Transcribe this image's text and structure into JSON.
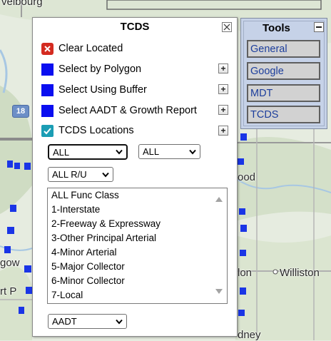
{
  "map": {
    "labels": {
      "top_left": "velbourg",
      "wood": "ood",
      "ton": "lon",
      "williston": "Williston",
      "gow": "gow",
      "rtp": "rt P",
      "dney": "dney"
    },
    "route_shield": "18",
    "colors": {
      "dots": "#1a35e6",
      "base": "#e6ece0"
    }
  },
  "tcds_panel": {
    "title": "TCDS",
    "close_icon": "close-icon",
    "clear_located": "Clear Located",
    "select_by_polygon": "Select by Polygon",
    "select_using_buffer": "Select Using Buffer",
    "select_aadt": "Select AADT & Growth Report",
    "tcds_locations": "TCDS Locations",
    "tcds_locations_checked": true,
    "expand_symbol": "+",
    "filter_1_value": "ALL",
    "filter_2_value": "ALL",
    "rural_urban_value": "ALL R/U",
    "func_class_items": [
      "ALL Func Class",
      "1-Interstate",
      "2-Freeway & Expressway",
      "3-Other Principal Arterial",
      "4-Minor Arterial",
      "5-Major Collector",
      "6-Minor Collector",
      "7-Local"
    ],
    "metric_value": "AADT"
  },
  "tools_panel": {
    "title": "Tools",
    "buttons": [
      "General",
      "Google",
      "MDT",
      "TCDS"
    ]
  }
}
